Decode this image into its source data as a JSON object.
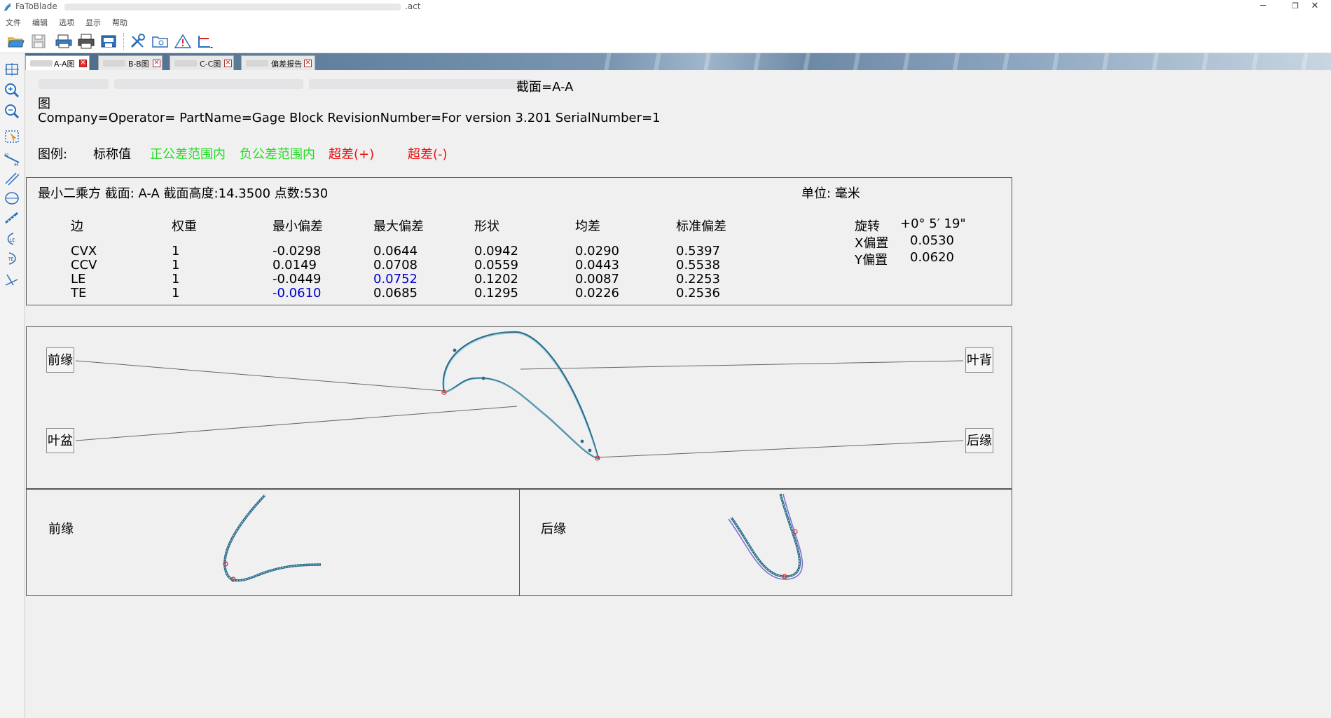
{
  "window": {
    "app_title": "FaToBlade",
    "doc_ext": ".act",
    "minimize": "─",
    "restore": "❐",
    "close": "✕"
  },
  "menu": [
    "文件",
    "编辑",
    "选项",
    "显示",
    "帮助"
  ],
  "tabs": [
    {
      "label": "A-A图",
      "active": true
    },
    {
      "label": "B-B图",
      "active": false
    },
    {
      "label": "C-C图",
      "active": false
    },
    {
      "label": "偏差报告",
      "active": false
    }
  ],
  "header": {
    "section": "截面=A-A",
    "figure_label": "图",
    "info_line": "Company=Operator= PartName=Gage Block RevisionNumber=For version 3.201 SerialNumber=1"
  },
  "legend": {
    "label": "图例:",
    "items": [
      {
        "text": "标称值",
        "color": "#000000"
      },
      {
        "text": "正公差范围内",
        "color": "#22dd22"
      },
      {
        "text": "负公差范围内",
        "color": "#22dd22"
      },
      {
        "text": "超差(+)",
        "color": "#ee1111"
      },
      {
        "text": "超差(-)",
        "color": "#ee1111"
      }
    ]
  },
  "stats": {
    "summary": "最小二乘方 截面: A-A 截面高度:14.3500 点数:530",
    "unit": "单位: 毫米",
    "columns": [
      "边",
      "权重",
      "最小偏差",
      "最大偏差",
      "形状",
      "均差",
      "标准偏差"
    ],
    "rows": [
      {
        "cells": [
          "CVX",
          "1",
          "-0.0298",
          "0.0644",
          "0.0942",
          "0.0290",
          "0.5397"
        ],
        "highlight": [
          false,
          false,
          false,
          false,
          false,
          false,
          false
        ]
      },
      {
        "cells": [
          "CCV",
          "1",
          "0.0149",
          "0.0708",
          "0.0559",
          "0.0443",
          "0.5538"
        ],
        "highlight": [
          false,
          false,
          false,
          false,
          false,
          false,
          false
        ]
      },
      {
        "cells": [
          "LE",
          "1",
          "-0.0449",
          "0.0752",
          "0.1202",
          "0.0087",
          "0.2253"
        ],
        "highlight": [
          false,
          false,
          false,
          true,
          false,
          false,
          false
        ]
      },
      {
        "cells": [
          "TE",
          "1",
          "-0.0610",
          "0.0685",
          "0.1295",
          "0.0226",
          "0.2536"
        ],
        "highlight": [
          false,
          false,
          true,
          false,
          false,
          false,
          false
        ]
      }
    ],
    "highlight_color": "#0000cc",
    "transform": [
      {
        "label": "旋转",
        "value": "+0° 5′ 19\""
      },
      {
        "label": "X偏置",
        "value": "0.0530"
      },
      {
        "label": "Y偏置",
        "value": "0.0620"
      }
    ]
  },
  "profile": {
    "leading_edge": "前缘",
    "suction_side": "叶背",
    "pressure_side": "叶盆",
    "trailing_edge": "后缘",
    "curve_color": "#2e6b8a"
  },
  "details": {
    "left_label": "前缘",
    "right_label": "后缘"
  }
}
